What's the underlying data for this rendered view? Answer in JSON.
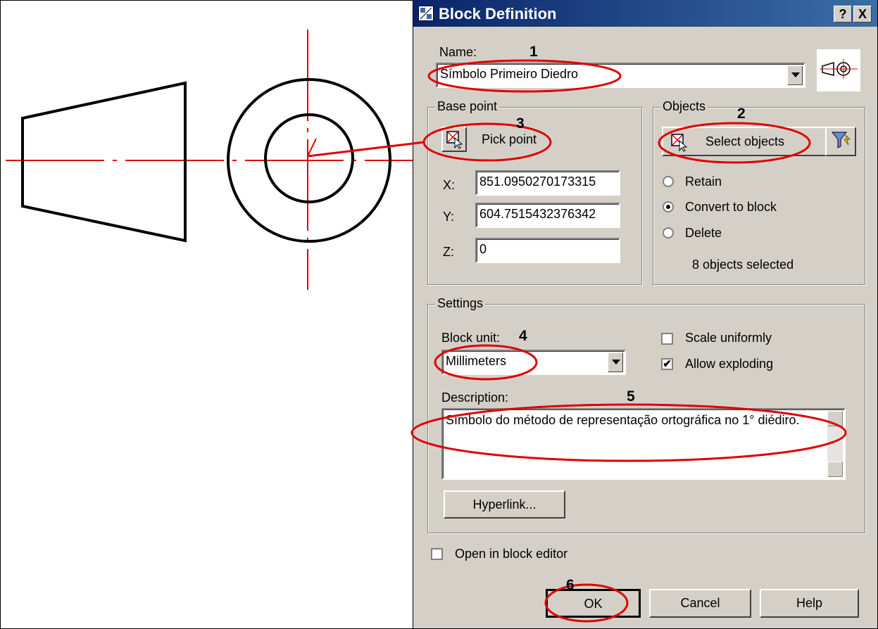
{
  "dialog": {
    "title": "Block Definition",
    "help_btn": "?",
    "close_btn": "X",
    "name_label": "Name:",
    "name_value": "Símbolo Primeiro Diedro",
    "base_point": {
      "title": "Base point",
      "pick_label": "Pick point",
      "x_label": "X:",
      "x_value": "851.0950270173315",
      "y_label": "Y:",
      "y_value": "604.7515432376342",
      "z_label": "Z:",
      "z_value": "0"
    },
    "objects": {
      "title": "Objects",
      "select_label": "Select objects",
      "retain": "Retain",
      "convert": "Convert to block",
      "delete": "Delete",
      "selected_count": "8 objects selected"
    },
    "settings": {
      "title": "Settings",
      "block_unit_label": "Block unit:",
      "block_unit_value": "Millimeters",
      "scale_uniformly": "Scale uniformly",
      "allow_exploding": "Allow exploding",
      "description_label": "Description:",
      "description_value": "Símbolo do método de representação ortográfica no 1° diédiro.",
      "hyperlink_btn": "Hyperlink..."
    },
    "open_editor": "Open in block editor",
    "ok": "OK",
    "cancel": "Cancel",
    "help": "Help"
  },
  "annotations": [
    "1",
    "2",
    "3",
    "4",
    "5",
    "6"
  ],
  "colors": {
    "title_start": "#0a246a",
    "title_end": "#3a6ea5",
    "annotation_red": "#e00000",
    "dialog_bg": "#d4d0c8"
  }
}
